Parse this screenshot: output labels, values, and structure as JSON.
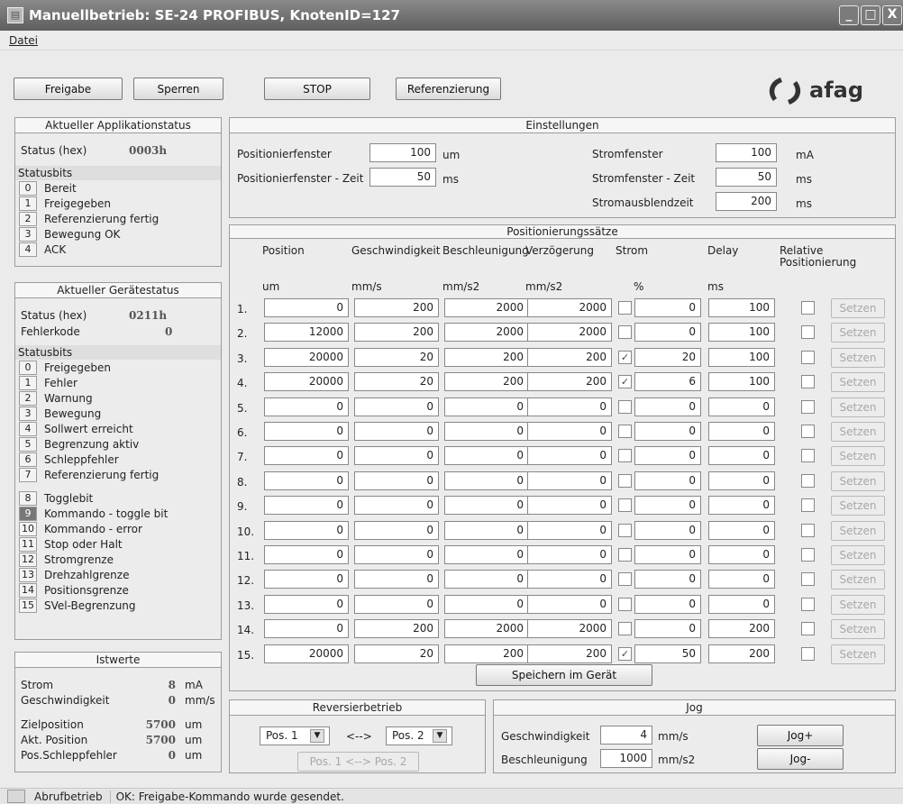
{
  "window": {
    "title": "Manuellbetrieb: SE-24 PROFIBUS, KnotenID=127",
    "min": "_",
    "max": "□",
    "close": "X"
  },
  "menu": {
    "file": "Datei"
  },
  "toolbar": {
    "freigabe": "Freigabe",
    "sperren": "Sperren",
    "stop": "STOP",
    "referenzierung": "Referenzierung"
  },
  "logo": {
    "text": "afag"
  },
  "app_status": {
    "title": "Aktueller Applikationstatus",
    "status_label": "Status (hex)",
    "status_value": "0003h",
    "bits_label": "Statusbits",
    "bits": [
      {
        "n": "0",
        "l": "Bereit"
      },
      {
        "n": "1",
        "l": "Freigegeben"
      },
      {
        "n": "2",
        "l": "Referenzierung fertig"
      },
      {
        "n": "3",
        "l": "Bewegung OK"
      },
      {
        "n": "4",
        "l": "ACK"
      }
    ]
  },
  "dev_status": {
    "title": "Aktueller Gerätestatus",
    "status_label": "Status (hex)",
    "status_value": "0211h",
    "fault_label": "Fehlerkode",
    "fault_value": "0",
    "bits_label": "Statusbits",
    "bits": [
      {
        "n": "0",
        "l": "Freigegeben"
      },
      {
        "n": "1",
        "l": "Fehler"
      },
      {
        "n": "2",
        "l": "Warnung"
      },
      {
        "n": "3",
        "l": "Bewegung"
      },
      {
        "n": "4",
        "l": "Sollwert erreicht"
      },
      {
        "n": "5",
        "l": "Begrenzung aktiv"
      },
      {
        "n": "6",
        "l": "Schleppfehler"
      },
      {
        "n": "7",
        "l": "Referenzierung fertig"
      },
      {
        "n": "8",
        "l": "Togglebit"
      },
      {
        "n": "9",
        "l": "Kommando - toggle bit",
        "active": true
      },
      {
        "n": "10",
        "l": "Kommando - error"
      },
      {
        "n": "11",
        "l": "Stop oder Halt"
      },
      {
        "n": "12",
        "l": "Stromgrenze"
      },
      {
        "n": "13",
        "l": "Drehzahlgrenze"
      },
      {
        "n": "14",
        "l": "Positionsgrenze"
      },
      {
        "n": "15",
        "l": "SVel-Begrenzung"
      }
    ]
  },
  "istwerte": {
    "title": "Istwerte",
    "rows": [
      {
        "l": "Strom",
        "v": "8",
        "u": "mA"
      },
      {
        "l": "Geschwindigkeit",
        "v": "0",
        "u": "mm/s"
      },
      {
        "l": "Zielposition",
        "v": "5700",
        "u": "um"
      },
      {
        "l": "Akt. Position",
        "v": "5700",
        "u": "um"
      },
      {
        "l": "Pos.Schleppfehler",
        "v": "0",
        "u": "um"
      }
    ]
  },
  "einstellungen": {
    "title": "Einstellungen",
    "posfenster": {
      "l": "Positionierfenster",
      "v": "100",
      "u": "um"
    },
    "posfenster_zeit": {
      "l": "Positionierfenster - Zeit",
      "v": "50",
      "u": "ms"
    },
    "stromfenster": {
      "l": "Stromfenster",
      "v": "100",
      "u": "mA"
    },
    "stromfenster_zeit": {
      "l": "Stromfenster - Zeit",
      "v": "50",
      "u": "ms"
    },
    "stromausblend": {
      "l": "Stromausblendzeit",
      "v": "200",
      "u": "ms"
    }
  },
  "saetze": {
    "title": "Positionierungssätze",
    "headers": [
      "Position",
      "Geschwindigkeit",
      "Beschleunigung",
      "Verzögerung",
      "Strom",
      "Delay",
      "Relative Positionierung"
    ],
    "units": [
      "um",
      "mm/s",
      "mm/s2",
      "mm/s2",
      "%",
      "ms"
    ],
    "set_label": "Setzen",
    "rows": [
      {
        "n": "1.",
        "pos": "0",
        "v": "200",
        "a": "2000",
        "d": "2000",
        "sc": false,
        "s": "0",
        "dl": "100"
      },
      {
        "n": "2.",
        "pos": "12000",
        "v": "200",
        "a": "2000",
        "d": "2000",
        "sc": false,
        "s": "0",
        "dl": "100"
      },
      {
        "n": "3.",
        "pos": "20000",
        "v": "20",
        "a": "200",
        "d": "200",
        "sc": true,
        "s": "20",
        "dl": "100"
      },
      {
        "n": "4.",
        "pos": "20000",
        "v": "20",
        "a": "200",
        "d": "200",
        "sc": true,
        "s": "6",
        "dl": "100"
      },
      {
        "n": "5.",
        "pos": "0",
        "v": "0",
        "a": "0",
        "d": "0",
        "sc": false,
        "s": "0",
        "dl": "0"
      },
      {
        "n": "6.",
        "pos": "0",
        "v": "0",
        "a": "0",
        "d": "0",
        "sc": false,
        "s": "0",
        "dl": "0"
      },
      {
        "n": "7.",
        "pos": "0",
        "v": "0",
        "a": "0",
        "d": "0",
        "sc": false,
        "s": "0",
        "dl": "0"
      },
      {
        "n": "8.",
        "pos": "0",
        "v": "0",
        "a": "0",
        "d": "0",
        "sc": false,
        "s": "0",
        "dl": "0"
      },
      {
        "n": "9.",
        "pos": "0",
        "v": "0",
        "a": "0",
        "d": "0",
        "sc": false,
        "s": "0",
        "dl": "0"
      },
      {
        "n": "10.",
        "pos": "0",
        "v": "0",
        "a": "0",
        "d": "0",
        "sc": false,
        "s": "0",
        "dl": "0"
      },
      {
        "n": "11.",
        "pos": "0",
        "v": "0",
        "a": "0",
        "d": "0",
        "sc": false,
        "s": "0",
        "dl": "0"
      },
      {
        "n": "12.",
        "pos": "0",
        "v": "0",
        "a": "0",
        "d": "0",
        "sc": false,
        "s": "0",
        "dl": "0"
      },
      {
        "n": "13.",
        "pos": "0",
        "v": "0",
        "a": "0",
        "d": "0",
        "sc": false,
        "s": "0",
        "dl": "0"
      },
      {
        "n": "14.",
        "pos": "0",
        "v": "200",
        "a": "2000",
        "d": "2000",
        "sc": false,
        "s": "0",
        "dl": "200"
      },
      {
        "n": "15.",
        "pos": "20000",
        "v": "20",
        "a": "200",
        "d": "200",
        "sc": true,
        "s": "50",
        "dl": "200"
      }
    ],
    "save": "Speichern im Gerät"
  },
  "reversier": {
    "title": "Reversierbetrieb",
    "pos1": "Pos. 1",
    "arrow": "<-->",
    "pos2": "Pos. 2",
    "button": "Pos. 1 <--> Pos. 2"
  },
  "jog": {
    "title": "Jog",
    "speed_label": "Geschwindigkeit",
    "speed": "4",
    "speed_unit": "mm/s",
    "acc_label": "Beschleunigung",
    "acc": "1000",
    "acc_unit": "mm/s2",
    "plus": "Jog+",
    "minus": "Jog-"
  },
  "statusbar": {
    "mode": "Abrufbetrieb",
    "message": "OK: Freigabe-Kommando wurde gesendet."
  }
}
